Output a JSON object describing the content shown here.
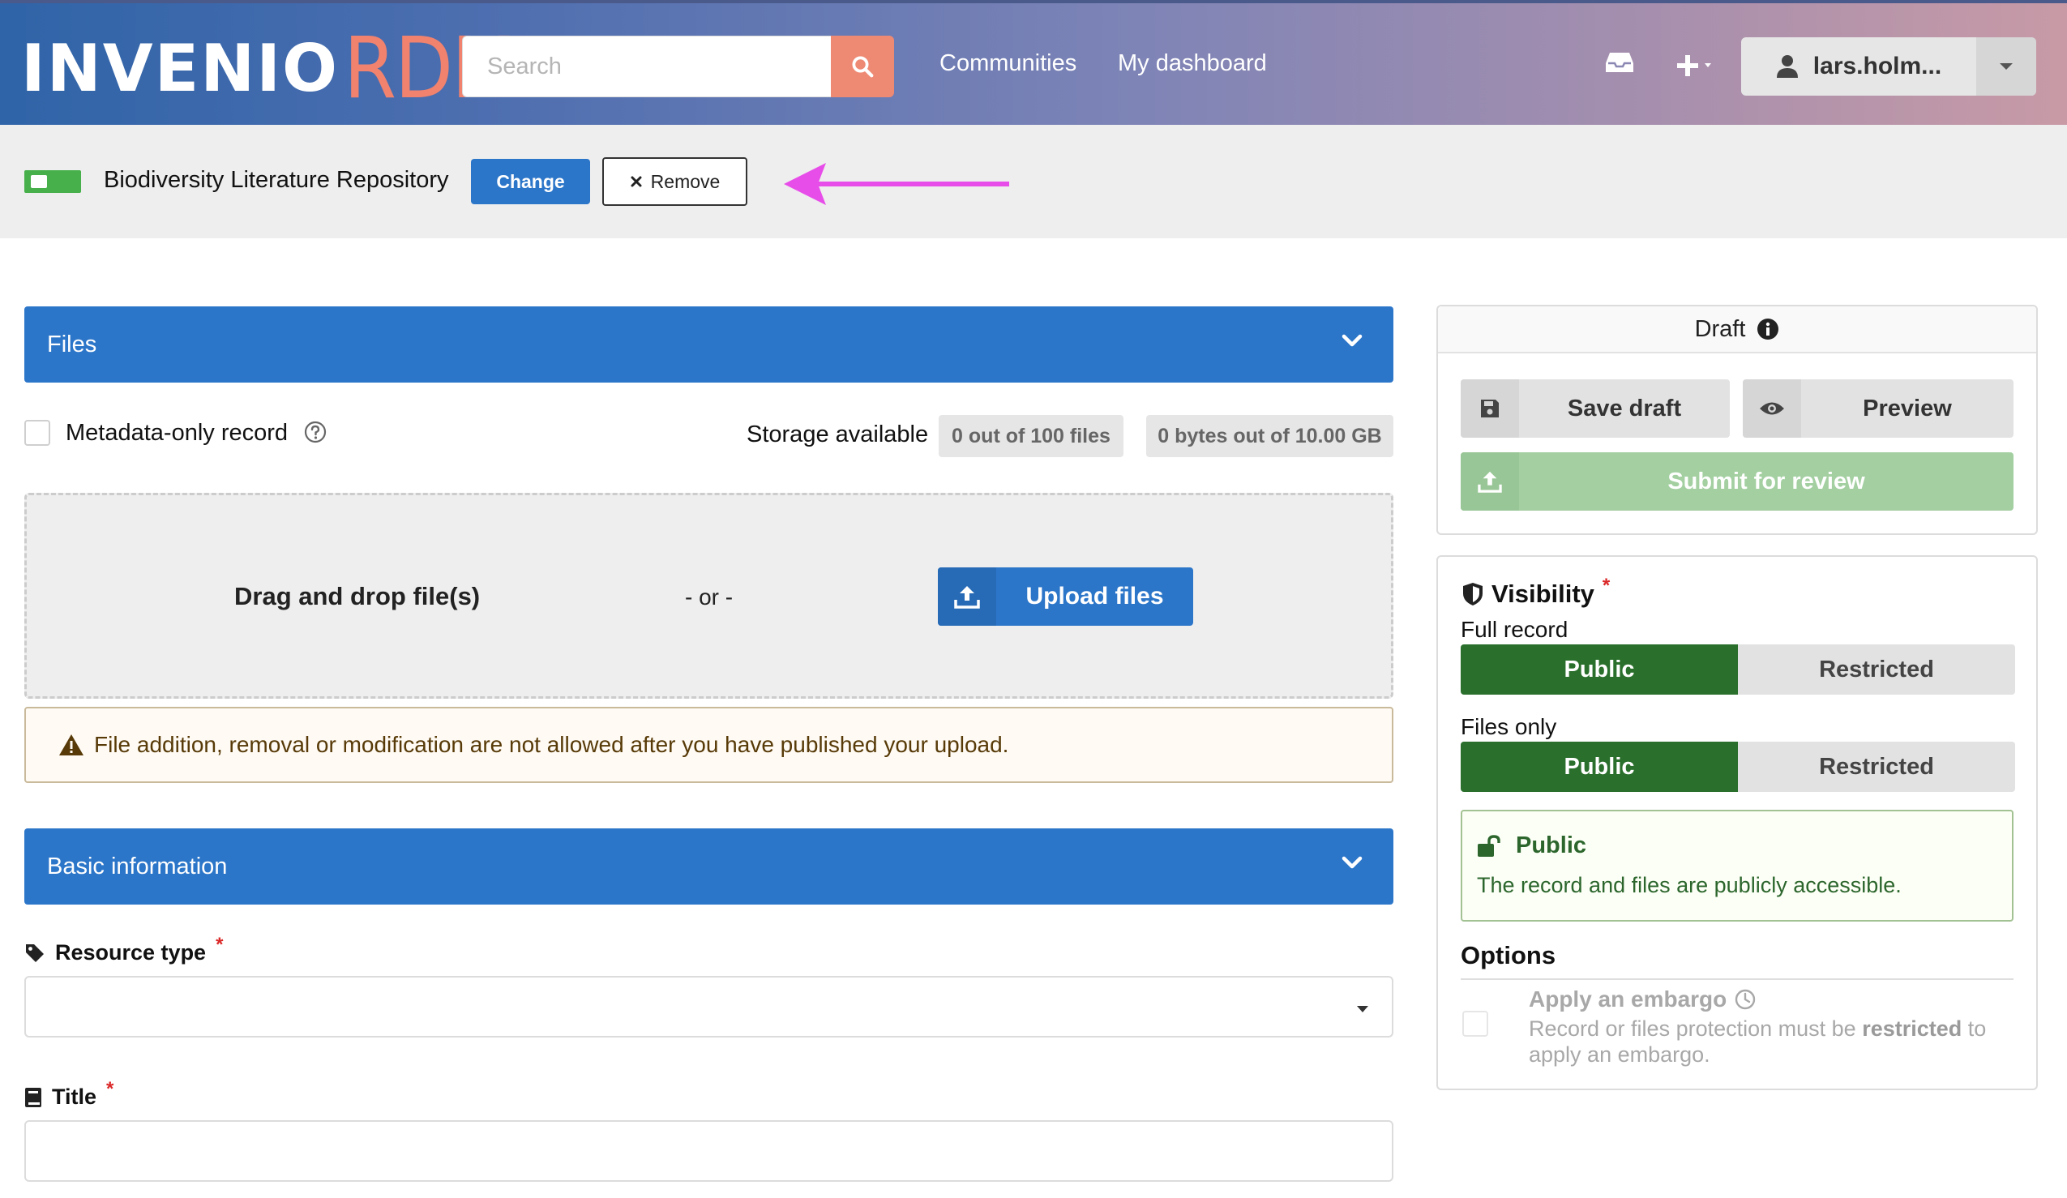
{
  "header": {
    "logo_main": "INVENIO",
    "logo_accent": "RDM",
    "search_placeholder": "Search",
    "nav": [
      "Communities",
      "My dashboard"
    ],
    "user_label": "lars.holm...",
    "icons": [
      "search-icon",
      "inbox-icon",
      "plus-icon",
      "user-icon",
      "caret-down-icon"
    ],
    "colors": {
      "search_button": "#ee8a74",
      "logo_accent": "#f0826e"
    }
  },
  "community": {
    "name": "Biodiversity Literature Repository",
    "change_label": "Change",
    "remove_label": "Remove",
    "annotation_arrow_color": "#e74de8"
  },
  "files_section": {
    "title": "Files",
    "metadata_only_label": "Metadata-only record",
    "storage_label": "Storage available",
    "files_pill": "0 out of 100 files",
    "bytes_pill": "0 bytes out of 10.00 GB",
    "dropzone_text": "Drag and drop file(s)",
    "or_text": "- or -",
    "upload_label": "Upload files",
    "warning_text": "File addition, removal or modification are not allowed after you have published your upload."
  },
  "basic_info": {
    "title": "Basic information",
    "resource_type_label": "Resource type",
    "title_label": "Title",
    "required_mark": "*"
  },
  "sidebar": {
    "draft_label": "Draft",
    "save_draft_label": "Save draft",
    "preview_label": "Preview",
    "submit_label": "Submit for review",
    "visibility_title": "Visibility",
    "required_mark": "*",
    "full_record_label": "Full record",
    "files_only_label": "Files only",
    "public_label": "Public",
    "restricted_label": "Restricted",
    "public_box_title": "Public",
    "public_box_desc": "The record and files are publicly accessible.",
    "options_title": "Options",
    "embargo_title": "Apply an embargo",
    "embargo_desc_1": "Record or files protection must be ",
    "embargo_desc_bold": "restricted",
    "embargo_desc_2": " to apply an embargo.",
    "colors": {
      "primary": "#2c76c9",
      "public_green": "#2a6f2c",
      "submit_disabled": "#a3cfa1"
    }
  }
}
